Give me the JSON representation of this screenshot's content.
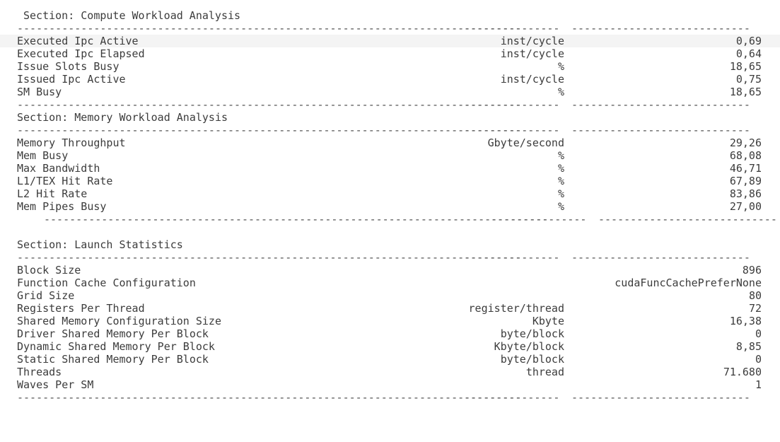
{
  "sections": [
    {
      "title": "Section: Compute Workload Analysis",
      "rows": [
        {
          "name": "Executed Ipc Active",
          "unit": "inst/cycle",
          "value": "0,69"
        },
        {
          "name": "Executed Ipc Elapsed",
          "unit": "inst/cycle",
          "value": "0,64"
        },
        {
          "name": "Issue Slots Busy",
          "unit": "%",
          "value": "18,65"
        },
        {
          "name": "Issued Ipc Active",
          "unit": "inst/cycle",
          "value": "0,75"
        },
        {
          "name": "SM Busy",
          "unit": "%",
          "value": "18,65"
        }
      ]
    },
    {
      "title": "Section: Memory Workload Analysis",
      "rows": [
        {
          "name": "Memory Throughput",
          "unit": "Gbyte/second",
          "value": "29,26"
        },
        {
          "name": "Mem Busy",
          "unit": "%",
          "value": "68,08"
        },
        {
          "name": "Max Bandwidth",
          "unit": "%",
          "value": "46,71"
        },
        {
          "name": "L1/TEX Hit Rate",
          "unit": "%",
          "value": "67,89"
        },
        {
          "name": "L2 Hit Rate",
          "unit": "%",
          "value": "83,86"
        },
        {
          "name": "Mem Pipes Busy",
          "unit": "%",
          "value": "27,00"
        }
      ]
    },
    {
      "title": "Section: Launch Statistics",
      "rows": [
        {
          "name": "Block Size",
          "unit": "",
          "value": "896"
        },
        {
          "name": "Function Cache Configuration",
          "unit": "",
          "value": "cudaFuncCachePreferNone"
        },
        {
          "name": "Grid Size",
          "unit": "",
          "value": "80"
        },
        {
          "name": "Registers Per Thread",
          "unit": "register/thread",
          "value": "72"
        },
        {
          "name": "Shared Memory Configuration Size",
          "unit": "Kbyte",
          "value": "16,38"
        },
        {
          "name": "Driver Shared Memory Per Block",
          "unit": "byte/block",
          "value": "0"
        },
        {
          "name": "Dynamic Shared Memory Per Block",
          "unit": "Kbyte/block",
          "value": "8,85"
        },
        {
          "name": "Static Shared Memory Per Block",
          "unit": "byte/block",
          "value": "0"
        },
        {
          "name": "Threads",
          "unit": "thread",
          "value": "71.680"
        },
        {
          "name": "Waves Per SM",
          "unit": "",
          "value": "1"
        }
      ]
    }
  ]
}
